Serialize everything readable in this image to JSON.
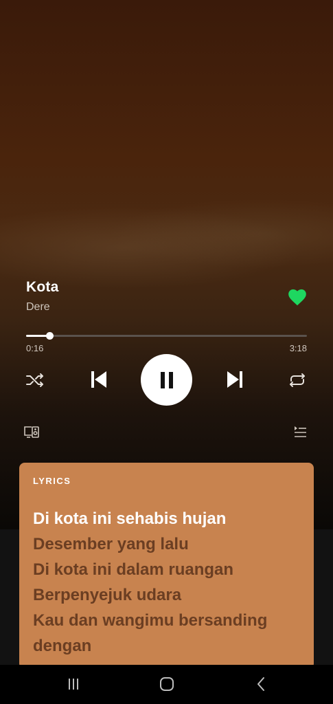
{
  "track": {
    "title": "Kota",
    "artist": "Dere",
    "liked": true
  },
  "playback": {
    "elapsed": "0:16",
    "duration": "3:18",
    "progress_fraction": 0.084,
    "state": "playing"
  },
  "controls": {
    "shuffle_icon": "shuffle-icon",
    "previous_icon": "skip-previous-icon",
    "play_pause_icon": "pause-icon",
    "next_icon": "skip-next-icon",
    "repeat_icon": "repeat-icon",
    "devices_icon": "devices-icon",
    "queue_icon": "queue-icon"
  },
  "lyrics": {
    "header": "LYRICS",
    "lines": [
      {
        "text": "Di kota ini sehabis hujan",
        "active": true
      },
      {
        "text": "Desember yang lalu",
        "active": false
      },
      {
        "text": "Di kota ini dalam ruangan",
        "active": false
      },
      {
        "text": "Berpenyejuk udara",
        "active": false
      },
      {
        "text": "Kau dan wangimu bersanding",
        "active": false
      },
      {
        "text": "dengan",
        "active": false
      }
    ]
  },
  "colors": {
    "accent_green": "#1ed760",
    "lyrics_card": "#c8834f",
    "lyric_inactive": "#6b3e22",
    "lyric_active": "#ffffff"
  },
  "system_nav": {
    "recents_icon": "recents-icon",
    "home_icon": "home-icon",
    "back_icon": "back-icon"
  }
}
